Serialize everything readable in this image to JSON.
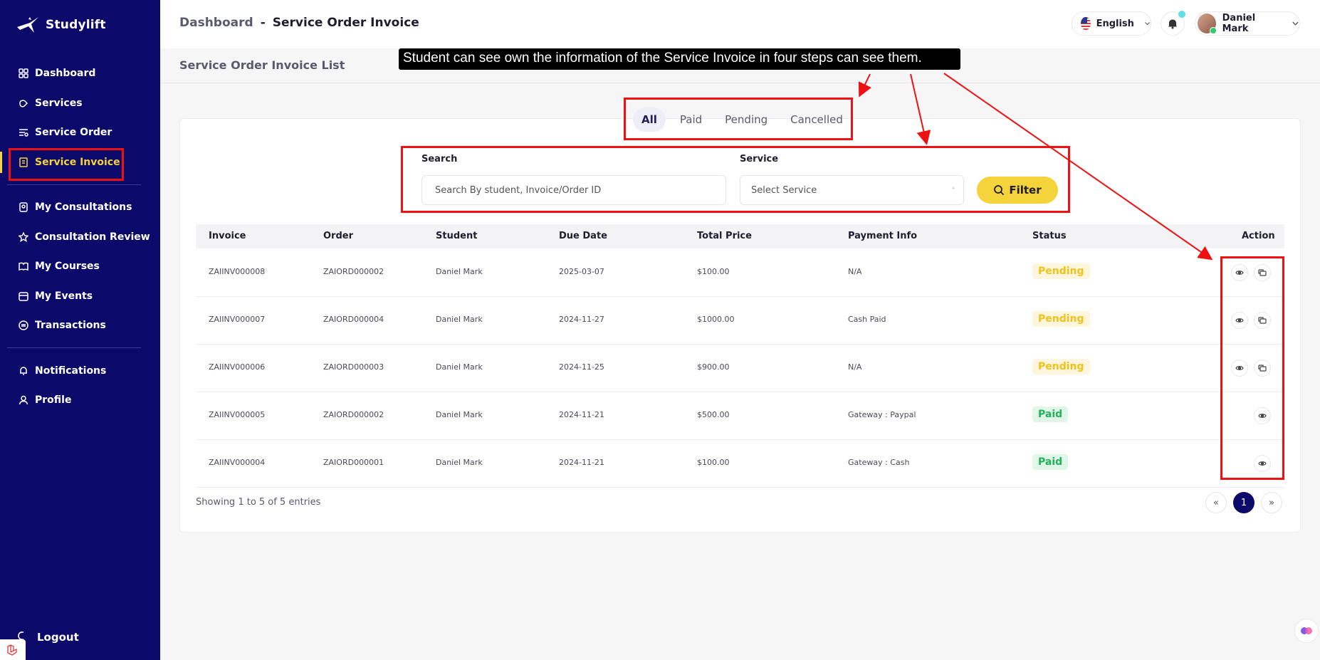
{
  "app": {
    "name": "Studylift"
  },
  "sidebar": {
    "items": [
      {
        "label": "Dashboard",
        "icon": "dashboard-icon"
      },
      {
        "label": "Services",
        "icon": "services-icon"
      },
      {
        "label": "Service Order",
        "icon": "service-order-icon"
      },
      {
        "label": "Service Invoice",
        "icon": "invoice-icon",
        "active": true
      },
      {
        "label": "My Consultations",
        "icon": "consultation-icon"
      },
      {
        "label": "Consultation Review",
        "icon": "star-icon"
      },
      {
        "label": "My Courses",
        "icon": "courses-icon"
      },
      {
        "label": "My Events",
        "icon": "calendar-icon"
      },
      {
        "label": "Transactions",
        "icon": "transactions-icon"
      },
      {
        "label": "Notifications",
        "icon": "bell-icon"
      },
      {
        "label": "Profile",
        "icon": "user-icon"
      }
    ],
    "logout": "Logout"
  },
  "header": {
    "crumb_parent": "Dashboard",
    "crumb_sep": "-",
    "crumb_current": "Service Order Invoice",
    "language": "English",
    "user_name": "Daniel Mark"
  },
  "page": {
    "list_title": "Service Order Invoice List"
  },
  "annotation": {
    "text": "Student can see own the information of the Service Invoice in four steps can see them."
  },
  "tabs": [
    "All",
    "Paid",
    "Pending",
    "Cancelled"
  ],
  "filters": {
    "search_label": "Search",
    "search_placeholder": "Search By student, Invoice/Order ID",
    "service_label": "Service",
    "service_value": "Select Service",
    "filter_button": "Filter"
  },
  "table": {
    "columns": [
      "Invoice",
      "Order",
      "Student",
      "Due Date",
      "Total Price",
      "Payment Info",
      "Status",
      "Action"
    ],
    "rows": [
      {
        "invoice": "ZAIINV000008",
        "order": "ZAIORD000002",
        "student": "Daniel Mark",
        "due": "2025-03-07",
        "total": "$100.00",
        "payment": "N/A",
        "status": "Pending"
      },
      {
        "invoice": "ZAIINV000007",
        "order": "ZAIORD000004",
        "student": "Daniel Mark",
        "due": "2024-11-27",
        "total": "$1000.00",
        "payment": "Cash Paid",
        "status": "Pending"
      },
      {
        "invoice": "ZAIINV000006",
        "order": "ZAIORD000003",
        "student": "Daniel Mark",
        "due": "2024-11-25",
        "total": "$900.00",
        "payment": "N/A",
        "status": "Pending"
      },
      {
        "invoice": "ZAIINV000005",
        "order": "ZAIORD000002",
        "student": "Daniel Mark",
        "due": "2024-11-21",
        "total": "$500.00",
        "payment": "Gateway : Paypal",
        "status": "Paid"
      },
      {
        "invoice": "ZAIINV000004",
        "order": "ZAIORD000001",
        "student": "Daniel Mark",
        "due": "2024-11-21",
        "total": "$100.00",
        "payment": "Gateway : Cash",
        "status": "Paid"
      }
    ]
  },
  "pagination": {
    "showing": "Showing 1 to 5 of 5 entries",
    "prev": "«",
    "page": "1",
    "next": "»"
  },
  "colors": {
    "sidebar": "#0b0a6b",
    "accent": "#f5d33a",
    "annotation_red": "#ee1111"
  }
}
